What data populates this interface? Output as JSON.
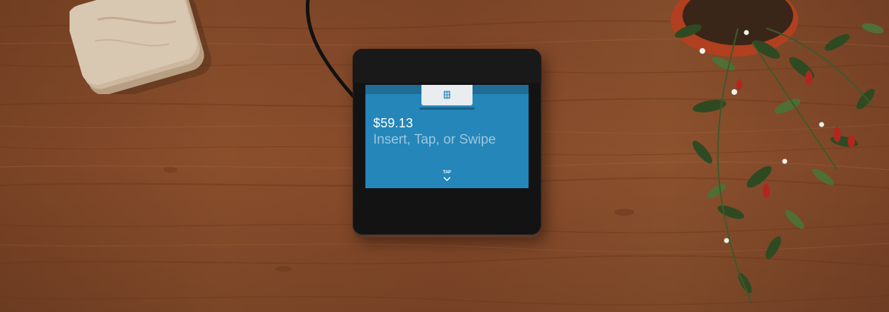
{
  "scene": {
    "description_objects": [
      "wood-table",
      "stone-coasters",
      "power-cable",
      "potted-pepper-plant",
      "payment-terminal"
    ]
  },
  "terminal": {
    "amount": "$59.13",
    "prompt": "Insert, Tap, or Swipe",
    "tap_label": "TAP",
    "icons": {
      "chip": "chip-card-icon",
      "tap": "chevron-down-icon"
    },
    "colors": {
      "screen": "#2486b9",
      "screen_band": "#1f6d97",
      "body": "#141314",
      "prompt_text": "#9ec6dc"
    }
  }
}
